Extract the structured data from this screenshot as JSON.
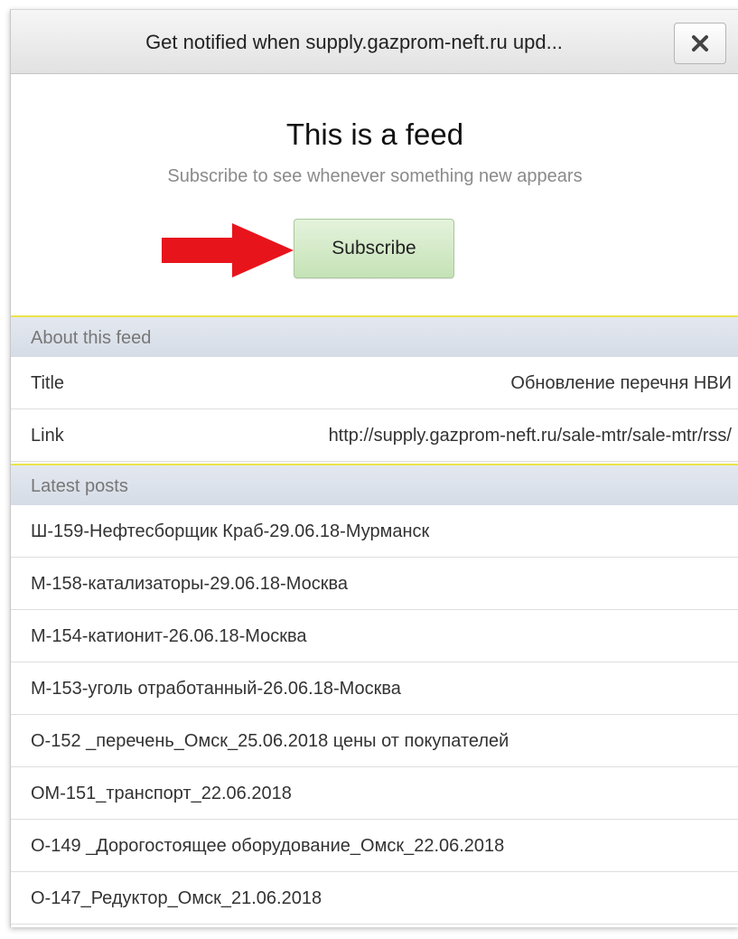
{
  "titlebar": {
    "title": "Get notified when supply.gazprom-neft.ru upd..."
  },
  "hero": {
    "title": "This is a feed",
    "subtitle": "Subscribe to see whenever something new appears",
    "subscribe_label": "Subscribe"
  },
  "colors": {
    "subscribe_bg": "#d2eac6",
    "arrow": "#e8141c",
    "section_header_bg": "#dde2ea",
    "section_header_border": "#ece34a"
  },
  "about": {
    "header": "About this feed",
    "rows": [
      {
        "key": "Title",
        "value": "Обновление перечня НВИ"
      },
      {
        "key": "Link",
        "value": "http://supply.gazprom-neft.ru/sale-mtr/sale-mtr/rss/"
      }
    ]
  },
  "latest": {
    "header": "Latest posts",
    "posts": [
      "Ш-159-Нефтесборщик Краб-29.06.18-Мурманск",
      "М-158-катализаторы-29.06.18-Москва",
      "М-154-катионит-26.06.18-Москва",
      "М-153-уголь отработанный-26.06.18-Москва",
      "О-152 _перечень_Омск_25.06.2018 цены от покупателей",
      "ОМ-151_транспорт_22.06.2018",
      "О-149 _Дорогостоящее оборудование_Омск_22.06.2018",
      "О-147_Редуктор_Омск_21.06.2018"
    ]
  }
}
